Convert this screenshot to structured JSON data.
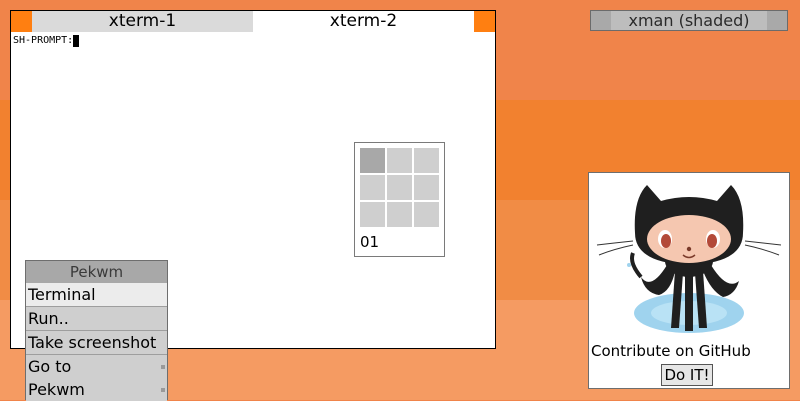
{
  "xman": {
    "title": "xman (shaded)"
  },
  "xterm": {
    "tabs": [
      "xterm-1",
      "xterm-2"
    ],
    "prompt": "SH-PROMPT:"
  },
  "pager": {
    "workspace_label": "01"
  },
  "menu": {
    "title": "Pekwm",
    "items": [
      "Terminal",
      "Run..",
      "Take screenshot",
      "Go to",
      "Pekwm"
    ]
  },
  "github": {
    "caption": "Contribute on GitHub",
    "button": "Do IT!"
  },
  "colors": {
    "accent_orange": "#ff7f11",
    "desktop_bands": [
      "#f0844a",
      "#f2812f",
      "#f18c45",
      "#f59b62"
    ]
  }
}
